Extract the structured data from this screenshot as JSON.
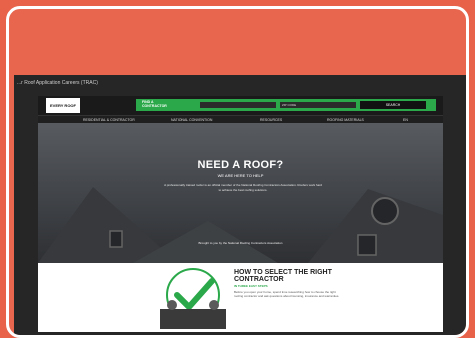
{
  "page": {
    "breadcrumb": "...r Roof Application Careers (TRAC)"
  },
  "site": {
    "logo_text": "EVERY ROOF",
    "find_label": "FIND A CONTRACTOR",
    "zip_placeholder": "ZIP CODE",
    "search_label": "SEARCH",
    "nav": [
      "RESIDENTIAL & CONTRACTOR",
      "NATIONAL CONVENTION",
      "RESOURCES",
      "ROOFING MATERIALS",
      "EN"
    ],
    "hero_title": "NEED A ROOF?",
    "hero_subtitle": "WE ARE HERE TO HELP",
    "hero_paragraph": "A professionally trained roofer is an official member of the National Roofing Contractors Association. Roofers work hard to achieve the best roofing solutions.",
    "hero_footer": "Brought to you by the National Roofing Contractors Association",
    "section_title": "HOW TO SELECT THE RIGHT CONTRACTOR",
    "section_subtitle": "IN THREE EASY STEPS",
    "section_paragraph": "Before you open your home, spend time researching how to choose the right roofing contractor and ask questions about licensing, insurance and warranties."
  },
  "colors": {
    "accent_orange": "#e8624a",
    "brand_green": "#2aa84a"
  }
}
